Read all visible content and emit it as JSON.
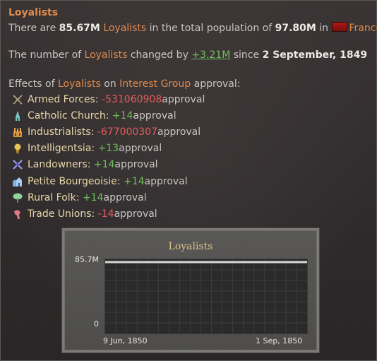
{
  "tooltip": {
    "title": "Loyalists",
    "population": {
      "prefix": "There are ",
      "count": "85.67M",
      "group": "Loyalists",
      "mid": " in the total population of ",
      "total": "97.80M",
      "in": " in ",
      "country": "France"
    },
    "change": {
      "prefix": "The number of ",
      "group": "Loyalists",
      "mid": " changed by ",
      "delta": "+3.21M",
      "since": " since ",
      "date": "2 September, 1849"
    },
    "effects": {
      "prefix": "Effects of ",
      "group": "Loyalists",
      "on": " on ",
      "target": "Interest Group",
      "suffix": " approval:"
    },
    "interest_groups": [
      {
        "name": "Armed Forces",
        "value": "-531060908",
        "tone": "red",
        "icon": "crossed-swords-icon",
        "suffix": " approval"
      },
      {
        "name": "Catholic Church",
        "value": "+14",
        "tone": "green",
        "icon": "church-spire-icon",
        "suffix": " approval"
      },
      {
        "name": "Industrialists",
        "value": "-677000307",
        "tone": "red",
        "icon": "factory-icon",
        "suffix": " approval"
      },
      {
        "name": "Intelligentsia",
        "value": "+13",
        "tone": "green",
        "icon": "lightbulb-icon",
        "suffix": " approval"
      },
      {
        "name": "Landowners",
        "value": "+14",
        "tone": "green",
        "icon": "windmill-icon",
        "suffix": " approval"
      },
      {
        "name": "Petite Bourgeoisie",
        "value": "+14",
        "tone": "green",
        "icon": "buildings-icon",
        "suffix": " approval"
      },
      {
        "name": "Rural Folk",
        "value": "+14",
        "tone": "green",
        "icon": "tree-icon",
        "suffix": " approval"
      },
      {
        "name": "Trade Unions",
        "value": "-14",
        "tone": "red",
        "icon": "raised-fist-icon",
        "suffix": " approval"
      }
    ]
  },
  "chart_data": {
    "type": "line",
    "title": "Loyalists",
    "x": [
      "9 Jun, 1850",
      "1 Sep, 1850"
    ],
    "series": [
      {
        "values": [
          85.7,
          85.7
        ]
      }
    ],
    "y_ticks": [
      "85.7M",
      "0"
    ],
    "x_ticks": [
      "9 Jun, 1850",
      "1 Sep, 1850"
    ],
    "ylim": [
      0,
      85.7
    ],
    "grid": true,
    "line_color": "#d8d8d8"
  },
  "colors": {
    "accent_orange": "#e08a4a",
    "positive_green": "#6fbf5a",
    "negative_red": "#e55b5b",
    "label_cream": "#e8d7a8"
  }
}
